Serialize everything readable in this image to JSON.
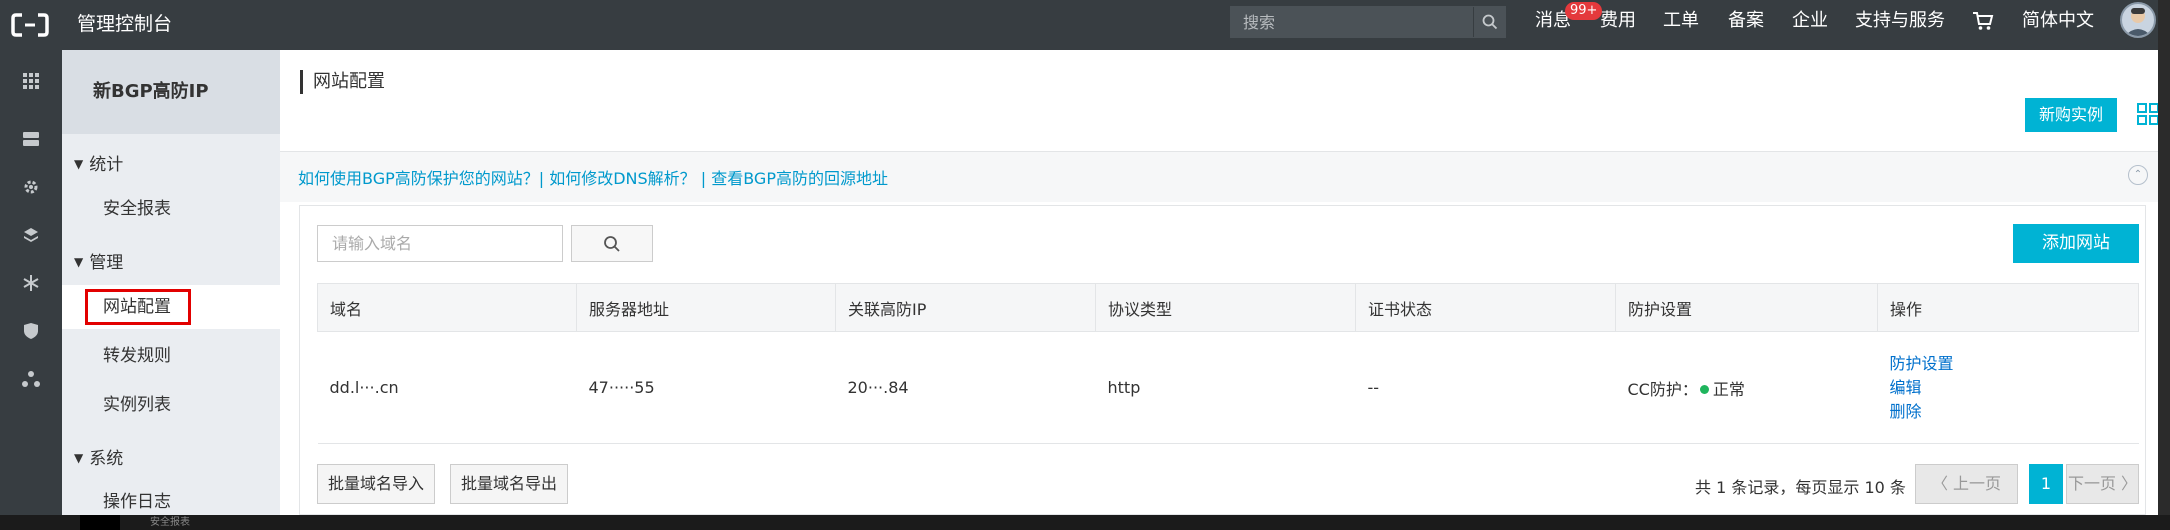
{
  "topbar": {
    "title": "管理控制台",
    "search_placeholder": "搜索",
    "nav": [
      "消息",
      "费用",
      "工单",
      "备案",
      "企业",
      "支持与服务",
      "简体中文"
    ],
    "badge": "99+"
  },
  "sidebar": {
    "product": "新BGP高防IP",
    "groups": [
      {
        "label": "统计",
        "items": [
          "安全报表"
        ]
      },
      {
        "label": "管理",
        "items": [
          "网站配置",
          "转发规则",
          "实例列表"
        ]
      },
      {
        "label": "系统",
        "items": [
          "操作日志"
        ]
      }
    ]
  },
  "main": {
    "page_title": "网站配置",
    "new_instance_label": "新购实例",
    "help_links": "如何使用BGP高防保护您的网站？| 如何修改DNS解析？ | 查看BGP高防的回源地址",
    "domain_placeholder": "请输入域名",
    "add_site_label": "添加网站",
    "table": {
      "headers": [
        "域名",
        "服务器地址",
        "关联高防IP",
        "协议类型",
        "证书状态",
        "防护设置",
        "操作"
      ],
      "rows": [
        {
          "domain": "dd.l···.cn",
          "server": "47·····55",
          "ip": "20···.84",
          "protocol": "http",
          "cert": "--",
          "protection_prefix": "CC防护：",
          "protection_status": "正常",
          "ops": [
            "防护设置",
            "编辑",
            "删除"
          ]
        }
      ]
    },
    "import_label": "批量域名导入",
    "export_label": "批量域名导出",
    "pager": {
      "info": "共 1 条记录，每页显示 10 条",
      "prev": "上一页",
      "current": "1",
      "next": "下一页"
    }
  },
  "bottom_strip_text": "安全报表",
  "colors": {
    "accent": "#00b3d4",
    "topbar": "#373d41",
    "link": "#0099cc",
    "highlight": "#e20000"
  }
}
